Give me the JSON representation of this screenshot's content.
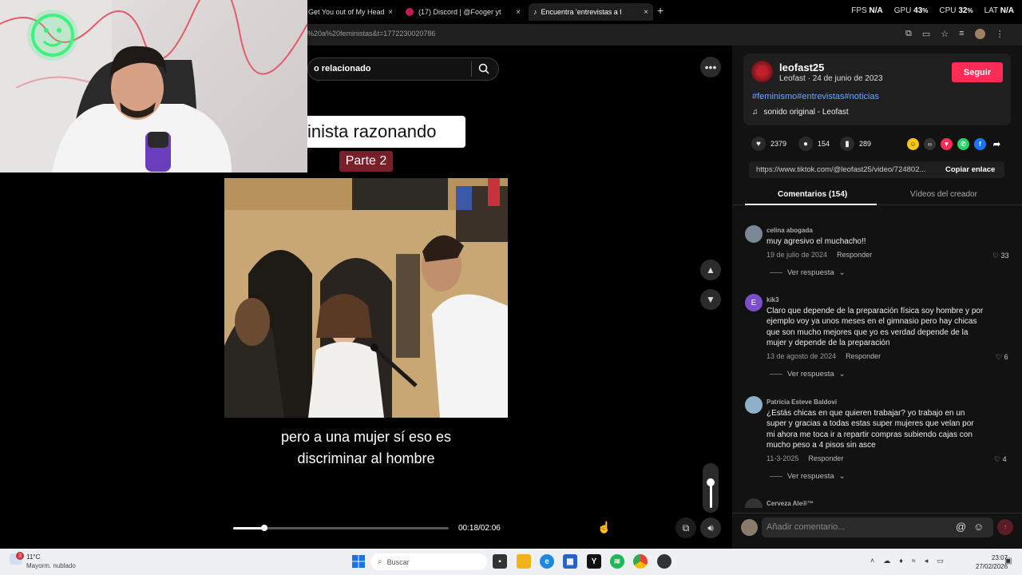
{
  "browser": {
    "tabs": [
      {
        "label": "Get You out of My Head"
      },
      {
        "label": "(17) Discord | @Fooger yt"
      },
      {
        "label": "Encuentra 'entrevistas a fe"
      }
    ],
    "new_tab": "+",
    "close": "×",
    "url": "%20a%20feministas&t=1772230020786"
  },
  "stats": {
    "fps_label": "FPS",
    "fps_value": "N/A",
    "gpu_label": "GPU",
    "gpu_value": "43",
    "cpu_label": "CPU",
    "cpu_value": "32",
    "lat_label": "LAT",
    "lat_value": "N/A"
  },
  "video": {
    "search_text": "o relacionado",
    "title_overlay": "inista razonando",
    "part_badge": "Parte 2",
    "subtitle_line1": "pero a una mujer sí eso es",
    "subtitle_line2": "discriminar al hombre",
    "timecode": "00:18/02:06",
    "progress": 0.143
  },
  "author": {
    "username": "leofast25",
    "subline": "Leofast · 24 de junio de 2023",
    "follow_label": "Seguir",
    "hashtags": "#feminismo#entrevistas#noticias",
    "sound": "sonido original - Leofast"
  },
  "actions": {
    "likes": "2379",
    "comments": "154",
    "saves": "289"
  },
  "link": {
    "url": "https://www.tiktok.com/@leofast25/video/724802...",
    "copy_label": "Copiar enlace"
  },
  "tabs": {
    "comments": "Comentarios (154)",
    "creator_videos": "Vídeos del creador"
  },
  "comments": [
    {
      "user": "celina abogada",
      "text": "muy agresivo el muchacho!!",
      "date": "19 de julio de 2024",
      "reply": "Responder",
      "likes": "33",
      "view": "Ver respuesta"
    },
    {
      "user": "kik3",
      "initial": "E",
      "text": "Claro que depende de la preparación física soy hombre y por ejemplo voy ya unos meses en el gimnasio pero hay chicas que son mucho mejores que yo es verdad depende de la mujer y depende de la preparación",
      "date": "13 de agosto de 2024",
      "reply": "Responder",
      "likes": "6",
      "view": "Ver respuesta"
    },
    {
      "user": "Patricia Esteve Baldovi",
      "text": "¿Estás chicas en que quieren trabajar? yo trabajo en un super y gracias a todas estas super mujeres que velan por mi ahora me toca ir a repartir compras subiendo cajas con mucho peso a 4 pisos sin asce",
      "date": "11-3-2025",
      "reply": "Responder",
      "likes": "4",
      "view": "Ver respuesta"
    },
    {
      "user": "Cerveza Ale®™"
    }
  ],
  "comment_input": {
    "placeholder": "Añadir comentario..."
  },
  "taskbar": {
    "weather_temp": "11°C",
    "weather_desc": "Mayorm. nublado",
    "weather_badge": "3",
    "search": "Buscar",
    "time": "23:07",
    "date": "27/02/2026"
  },
  "colors": {
    "accent": "#fe2c55",
    "hashtag": "#69a8ff",
    "badge": "#7a1f2a"
  }
}
